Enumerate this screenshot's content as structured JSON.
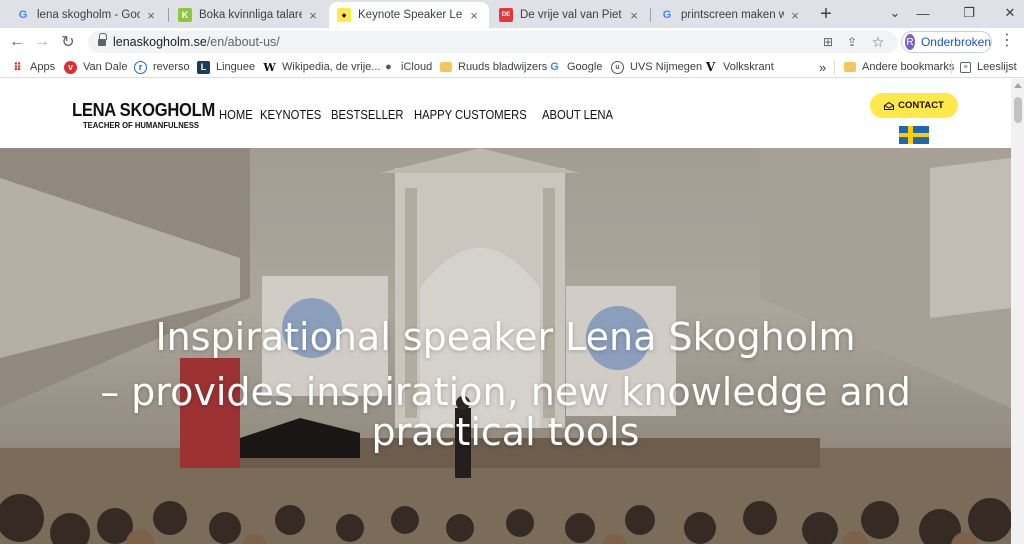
{
  "browser": {
    "tabs": [
      {
        "title": "lena skogholm - Google Z",
        "favicon": "google-icon"
      },
      {
        "title": "Boka kvinnliga talare - Kvi",
        "favicon": "k-icon"
      },
      {
        "title": "Keynote Speaker Lena Sk",
        "favicon": "speaker-icon",
        "active": true
      },
      {
        "title": "De vrije val van Piet Vroo",
        "favicon": "de-icon"
      },
      {
        "title": "printscreen maken windo",
        "favicon": "google-icon"
      }
    ],
    "url_domain": "lenaskogholm.se",
    "url_path": "/en/about-us/",
    "profile": {
      "initial": "R",
      "label": "Onderbroken"
    },
    "bookmarks": [
      {
        "label": "Apps",
        "icon": "apps-grid-icon"
      },
      {
        "label": "Van Dale",
        "icon": "vandale-icon"
      },
      {
        "label": "reverso",
        "icon": "reverso-icon"
      },
      {
        "label": "Linguee",
        "icon": "linguee-icon"
      },
      {
        "label": "Wikipedia, de vrije...",
        "icon": "wikipedia-icon"
      },
      {
        "label": "iCloud",
        "icon": "apple-icon"
      },
      {
        "label": "Ruuds bladwijzers",
        "icon": "folder-icon"
      },
      {
        "label": "Google",
        "icon": "google-icon"
      },
      {
        "label": "UVS Nijmegen",
        "icon": "uvs-icon"
      },
      {
        "label": "Volkskrant",
        "icon": "volkskrant-icon"
      }
    ],
    "more_bookmarks": "»",
    "other_bookmarks": "Andere bookmarks",
    "reading_list": "Leeslijst"
  },
  "site": {
    "logo_title": "LENA SKOGHOLM",
    "logo_subtitle": "TEACHER OF HUMANFULNESS",
    "nav": [
      "HOME",
      "KEYNOTES",
      "BESTSELLER",
      "HAPPY CUSTOMERS",
      "ABOUT LENA"
    ],
    "contact_label": "CONTACT",
    "hero_line1": "Inspirational speaker Lena Skogholm",
    "hero_line2": "– provides inspiration, new knowledge and",
    "hero_line3": "practical tools"
  },
  "colors": {
    "contact_yellow": "#ffe84a",
    "flag_blue": "#1f67b1",
    "flag_yellow": "#ffcd00",
    "tabstrip": "#dee1e6",
    "profile_text": "#1a56c6"
  }
}
